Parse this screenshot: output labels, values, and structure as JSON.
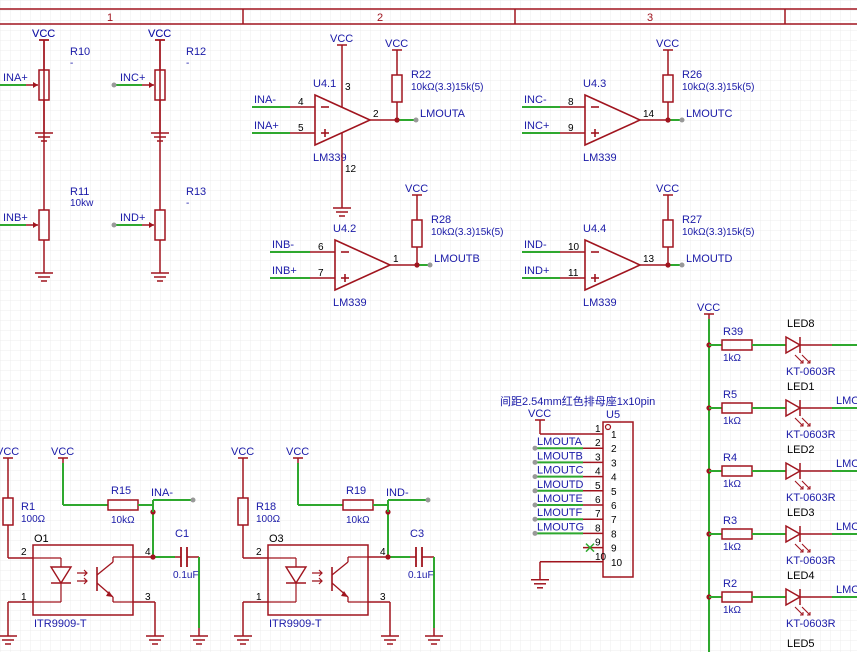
{
  "frame": {
    "columns": [
      "1",
      "2",
      "3"
    ]
  },
  "power": {
    "vcc": "VCC"
  },
  "pots": [
    {
      "ref": "R10",
      "value": "-",
      "net": "INA+"
    },
    {
      "ref": "R12",
      "value": "-",
      "net": "INC+"
    },
    {
      "ref": "R11",
      "value": "10kw",
      "net": "INB+"
    },
    {
      "ref": "R13",
      "value": "-",
      "net": "IND+"
    }
  ],
  "comparators": [
    {
      "unit": "U4.1",
      "part": "LM339",
      "in_minus": "INA-",
      "in_plus": "INA+",
      "pin_minus": "4",
      "pin_plus": "5",
      "pin_out": "2",
      "pin_top": "3",
      "pin_bot": "12",
      "pullup_ref": "R22",
      "pullup_val": "10kΩ(3.3)15k(5)",
      "out_net": "LMOUTA"
    },
    {
      "unit": "U4.2",
      "part": "LM339",
      "in_minus": "INB-",
      "in_plus": "INB+",
      "pin_minus": "6",
      "pin_plus": "7",
      "pin_out": "1",
      "pullup_ref": "R28",
      "pullup_val": "10kΩ(3.3)15k(5)",
      "out_net": "LMOUTB"
    },
    {
      "unit": "U4.3",
      "part": "LM339",
      "in_minus": "INC-",
      "in_plus": "INC+",
      "pin_minus": "8",
      "pin_plus": "9",
      "pin_out": "14",
      "pullup_ref": "R26",
      "pullup_val": "10kΩ(3.3)15k(5)",
      "out_net": "LMOUTC"
    },
    {
      "unit": "U4.4",
      "part": "LM339",
      "in_minus": "IND-",
      "in_plus": "IND+",
      "pin_minus": "10",
      "pin_plus": "11",
      "pin_out": "13",
      "pullup_ref": "R27",
      "pullup_val": "10kΩ(3.3)15k(5)",
      "out_net": "LMOUTD"
    }
  ],
  "header": {
    "title": "间距2.54mm红色排母座1x10pin",
    "ref": "U5",
    "nets": [
      "LMOUTA",
      "LMOUTB",
      "LMOUTC",
      "LMOUTD",
      "LMOUTE",
      "LMOUTF",
      "LMOUTG"
    ],
    "pins": [
      "1",
      "2",
      "3",
      "4",
      "5",
      "6",
      "7",
      "8",
      "9",
      "10"
    ]
  },
  "sensors": [
    {
      "r_ref": "R1",
      "r_val": "100Ω",
      "pull_ref": "R15",
      "pull_val": "10kΩ",
      "cap_ref": "C1",
      "cap_val": "0.1uF",
      "opto_ref": "O1",
      "opto_part": "ITR9909-T",
      "out_net": "INA-",
      "p1": "1",
      "p2": "2",
      "p3": "3",
      "p4": "4"
    },
    {
      "r_ref": "R18",
      "r_val": "100Ω",
      "pull_ref": "R19",
      "pull_val": "10kΩ",
      "cap_ref": "C3",
      "cap_val": "0.1uF",
      "opto_ref": "O3",
      "opto_part": "ITR9909-T",
      "out_net": "IND-",
      "p1": "1",
      "p2": "2",
      "p3": "3",
      "p4": "4"
    }
  ],
  "leds": [
    {
      "r_ref": "R39",
      "r_val": "1kΩ",
      "led_ref": "LED8",
      "part": "KT-0603R",
      "net": ""
    },
    {
      "r_ref": "R5",
      "r_val": "1kΩ",
      "led_ref": "LED1",
      "part": "KT-0603R",
      "net": "LMO"
    },
    {
      "r_ref": "R4",
      "r_val": "1kΩ",
      "led_ref": "LED2",
      "part": "KT-0603R",
      "net": "LMO"
    },
    {
      "r_ref": "R3",
      "r_val": "1kΩ",
      "led_ref": "LED3",
      "part": "KT-0603R",
      "net": "LMO"
    },
    {
      "r_ref": "R2",
      "r_val": "1kΩ",
      "led_ref": "LED4",
      "part": "KT-0603R",
      "net": "LMO"
    }
  ],
  "led_next": "LED5",
  "colors": {
    "symbol": "#a0141e",
    "wire": "#2ea82e",
    "text": "#1a1aa8",
    "ground": "#a0141e",
    "grid": "#ececec"
  }
}
